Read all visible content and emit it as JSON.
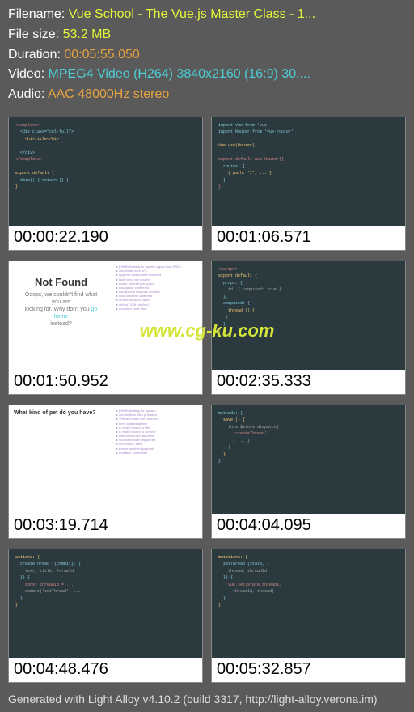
{
  "header": {
    "filename_label": "Filename: ",
    "filename_value": "Vue School - The Vue.js Master Class - 1...",
    "filesize_label": "File size: ",
    "filesize_value": "53.2 MB",
    "duration_label": "Duration: ",
    "duration_value": "00:05:55.050",
    "video_label": "Video: ",
    "video_value": "MPEG4 Video (H264) 3840x2160 (16:9) 30....",
    "audio_label": "Audio: ",
    "audio_value": "AAC 48000Hz stereo"
  },
  "thumbnails": [
    {
      "time": "00:00:22.190",
      "kind": "code-dark"
    },
    {
      "time": "00:01:06.571",
      "kind": "code-dark"
    },
    {
      "time": "00:01:50.952",
      "kind": "notfound"
    },
    {
      "time": "00:02:35.333",
      "kind": "code-dark"
    },
    {
      "time": "00:03:19.714",
      "kind": "pet"
    },
    {
      "time": "00:04:04.095",
      "kind": "code-dark"
    },
    {
      "time": "00:04:48.476",
      "kind": "code-dark"
    },
    {
      "time": "00:05:32.857",
      "kind": "code-dark"
    }
  ],
  "notfound": {
    "title": "Not Found",
    "text1": "Ooops, we couldn't find what you are",
    "text2": "looking for. Why don't you ",
    "link": "go home",
    "text3": "instead?"
  },
  "pet": {
    "question": "What kind of pet do you have?"
  },
  "watermark": "www.cg-ku.com",
  "footer": "Generated with Light Alloy v4.10.2 (build 3317, http://light-alloy.verona.im)"
}
